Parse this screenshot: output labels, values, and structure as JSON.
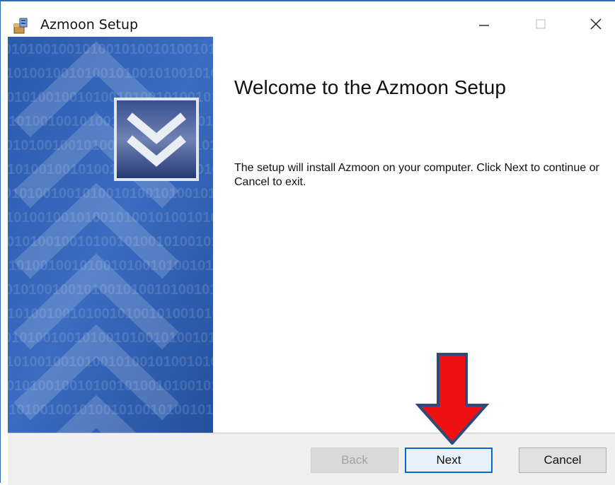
{
  "window": {
    "title": "Azmoon Setup",
    "app_icon": "installer-package-icon",
    "controls": {
      "minimize": "minimize-icon",
      "maximize": "maximize-icon",
      "close": "close-icon"
    }
  },
  "banner": {
    "binary_pattern": "01010010010100101001010010100100101001",
    "logo_icon": "double-chevron-down-icon"
  },
  "content": {
    "title": "Welcome to the Azmoon Setup",
    "body": "The setup will install Azmoon on your computer. Click Next to continue or Cancel to exit."
  },
  "footer": {
    "back_label": "Back",
    "next_label": "Next",
    "cancel_label": "Cancel"
  },
  "annotation": {
    "arrow_icon": "red-arrow-down-icon",
    "color": "#ee1111",
    "outline": "#2f4a7a"
  },
  "colors": {
    "window_border": "#2b6cb5",
    "banner_blue": "#2d5aa8",
    "next_border": "#0a67c7"
  }
}
